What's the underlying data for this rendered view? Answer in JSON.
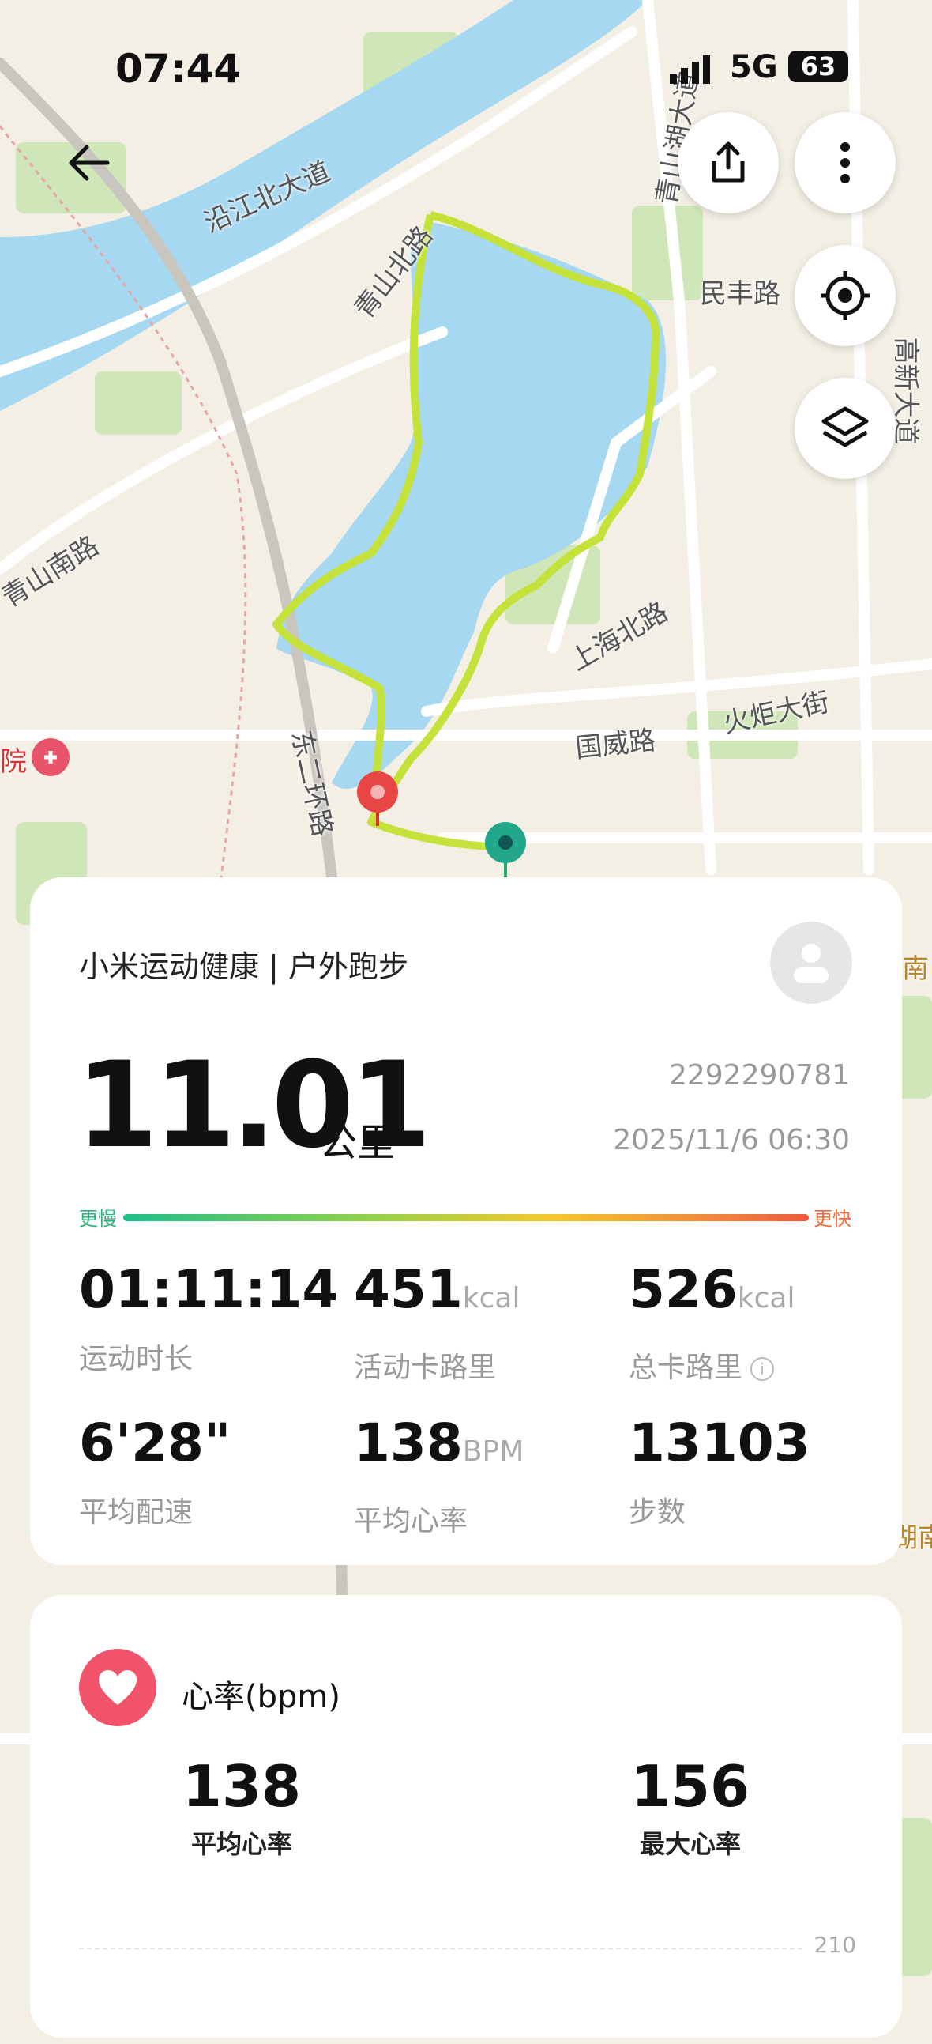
{
  "status_bar": {
    "time": "07:44",
    "network": "5G",
    "battery": "63"
  },
  "map": {
    "labels": {
      "road1": "沿江北大道",
      "road2": "青山北路",
      "road3": "青山湖大道",
      "road4": "民丰路",
      "road5": "高新大道",
      "road6": "青山南路",
      "road7": "上海北路",
      "road8": "国威路",
      "road9": "火炬大街",
      "road10": "东二环路",
      "poi1": "院",
      "edge1": "南",
      "edge2": "湖南"
    },
    "route_color": "#c5e23a"
  },
  "summary": {
    "source": "小米运动健康 | 户外跑步",
    "distance": "11.01",
    "distance_unit": "公里",
    "record_id": "2292290781",
    "datetime": "2025/11/6 06:30",
    "pace_slow": "更慢",
    "pace_fast": "更快",
    "stats": [
      {
        "value": "01:11:14",
        "unit": "",
        "label": "运动时长"
      },
      {
        "value": "451",
        "unit": "kcal",
        "label": "活动卡路里"
      },
      {
        "value": "526",
        "unit": "kcal",
        "label": "总卡路里"
      },
      {
        "value": "6'28\"",
        "unit": "",
        "label": "平均配速"
      },
      {
        "value": "138",
        "unit": "BPM",
        "label": "平均心率"
      },
      {
        "value": "13103",
        "unit": "",
        "label": "步数"
      }
    ]
  },
  "heart_rate": {
    "title": "心率(bpm)",
    "avg_value": "138",
    "avg_label": "平均心率",
    "max_value": "156",
    "max_label": "最大心率",
    "axis_top": "210"
  },
  "colors": {
    "heart": "#f1536b",
    "water": "#a6d8f2",
    "route": "#c5e23a"
  }
}
